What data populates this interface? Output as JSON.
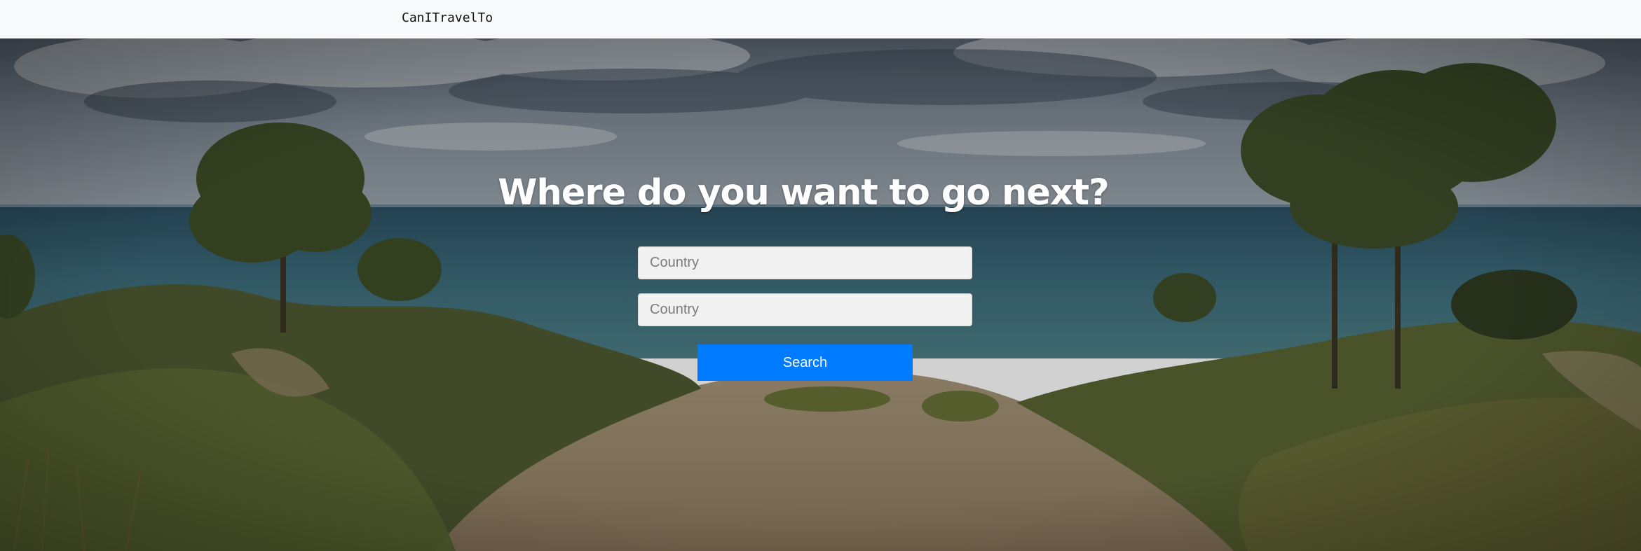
{
  "navbar": {
    "brand": "CanITravelTo"
  },
  "hero": {
    "headline": "Where do you want to go next?",
    "background": "beach-dunes-photo",
    "fields": [
      {
        "placeholder": "Country",
        "value": ""
      },
      {
        "placeholder": "Country",
        "value": ""
      }
    ],
    "search_label": "Search"
  },
  "colors": {
    "navbar_bg": "#f8f9fb",
    "accent": "#007bff",
    "input_bg": "#f1f1f1",
    "headline": "#ffffff"
  }
}
